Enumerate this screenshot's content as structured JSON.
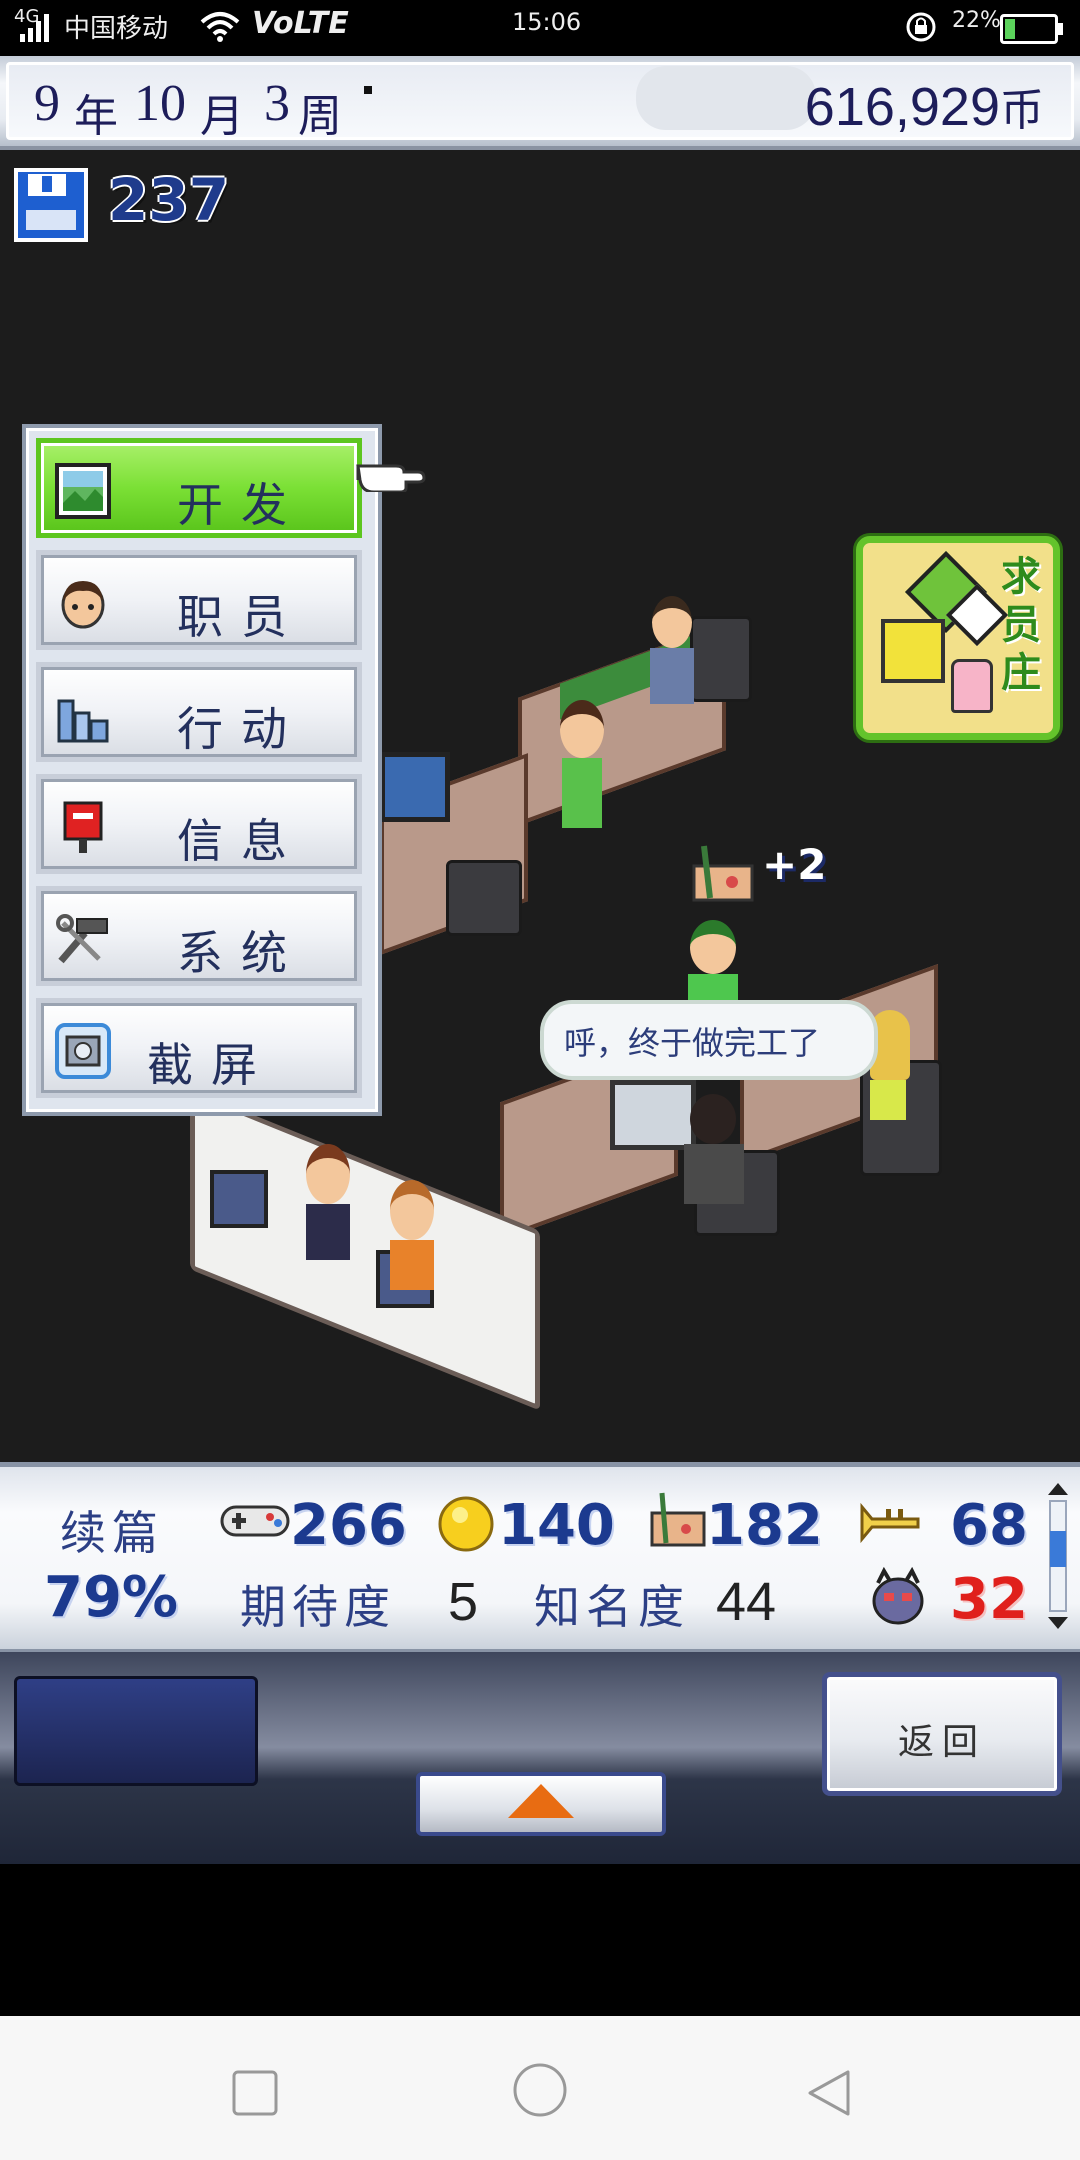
{
  "status_bar": {
    "signal": "4G",
    "carrier": "中国移动",
    "network": "VoLTE",
    "time": "15:06",
    "battery": "22%",
    "battery_level": 0.22
  },
  "date_bar": {
    "year": "9",
    "year_unit": "年",
    "month": "10",
    "month_unit": "月",
    "week": "3",
    "week_unit": "周",
    "money": "616,929",
    "money_unit": "币"
  },
  "points": "237",
  "menu": {
    "items": [
      {
        "label": "开发",
        "icon": "develop-icon",
        "active": true
      },
      {
        "label": "职员",
        "icon": "staff-icon",
        "active": false
      },
      {
        "label": "行动",
        "icon": "city-icon",
        "active": false
      },
      {
        "label": "信息",
        "icon": "mailbox-icon",
        "active": false
      },
      {
        "label": "系统",
        "icon": "tools-icon",
        "active": false
      },
      {
        "label": "截屏",
        "icon": "camera-icon",
        "active": false
      }
    ]
  },
  "recruit_badge": "求员庄",
  "scene": {
    "boost_text": "+2",
    "speech_bubble": "呼，终于做完工了"
  },
  "stats": {
    "title": "续篇",
    "progress": "79%",
    "fun": "266",
    "creativity": "140",
    "graphics": "182",
    "sound": "68",
    "bugs": "32",
    "expectation_label": "期待度",
    "expectation_value": "5",
    "fame_label": "知名度",
    "fame_value": "44"
  },
  "bottom": {
    "return_label": "返回"
  },
  "colors": {
    "accent_green": "#7be035",
    "navy_text": "#1d1d5a",
    "bug_red": "#e0201c"
  }
}
